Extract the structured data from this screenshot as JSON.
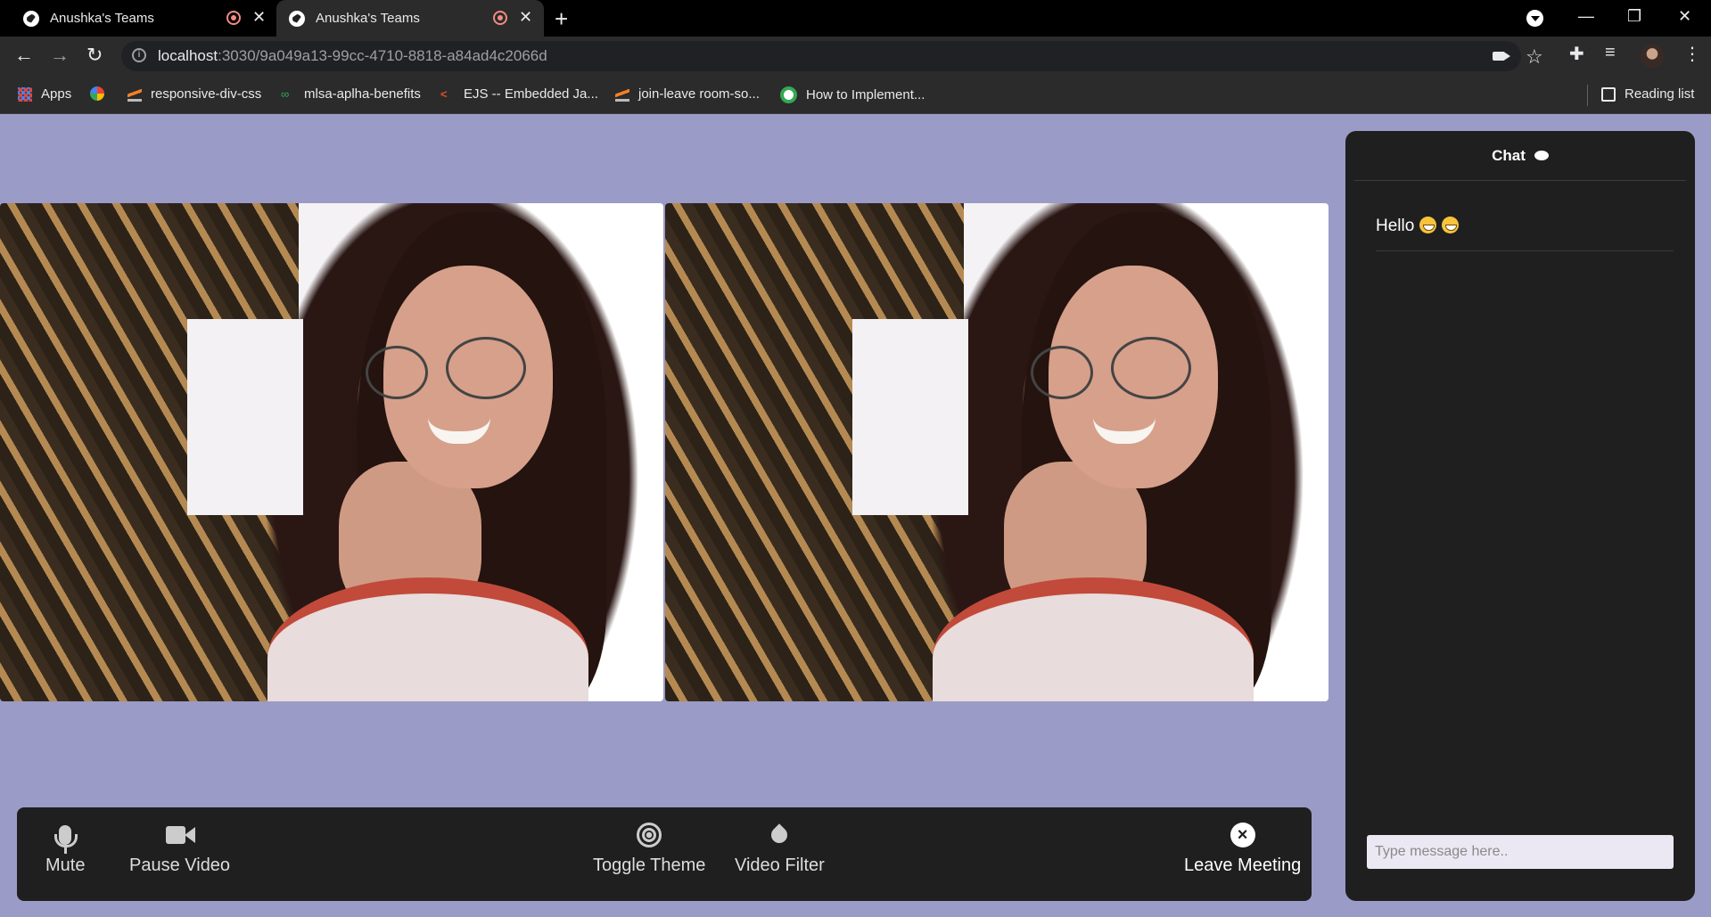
{
  "browser": {
    "tabs": [
      {
        "title": "Anushka's Teams",
        "recording": true,
        "active": false
      },
      {
        "title": "Anushka's Teams",
        "recording": true,
        "active": true
      }
    ],
    "url_host": "localhost",
    "url_path": ":3030/9a049a13-99cc-4710-8818-a84ad4c2066d",
    "bookmarks": [
      {
        "label": "Apps",
        "icon": "apps-grid-icon"
      },
      {
        "label": "",
        "icon": "pinwheel-icon"
      },
      {
        "label": "responsive-div-css",
        "icon": "stackoverflow-icon"
      },
      {
        "label": "mlsa-aplha-benefits",
        "icon": "link-icon"
      },
      {
        "label": "EJS -- Embedded Ja...",
        "icon": "ejs-icon"
      },
      {
        "label": "join-leave room-so...",
        "icon": "stackoverflow-icon"
      },
      {
        "label": "How to Implement...",
        "icon": "leaf-icon"
      }
    ],
    "reading_list": "Reading list"
  },
  "videos": [
    {
      "label": "local-video"
    },
    {
      "label": "remote-video"
    }
  ],
  "controls": {
    "mute": "Mute",
    "pause_video": "Pause Video",
    "toggle_theme": "Toggle Theme",
    "video_filter": "Video Filter",
    "leave_meeting": "Leave Meeting"
  },
  "chat": {
    "title": "Chat",
    "messages": [
      {
        "text": "Hello",
        "emojis": 2
      }
    ],
    "input_placeholder": "Type message here.."
  },
  "colors": {
    "page_bg": "#9a9bc6",
    "panel_bg": "#1f1f1f",
    "chrome_bg": "#2b2b2b"
  }
}
